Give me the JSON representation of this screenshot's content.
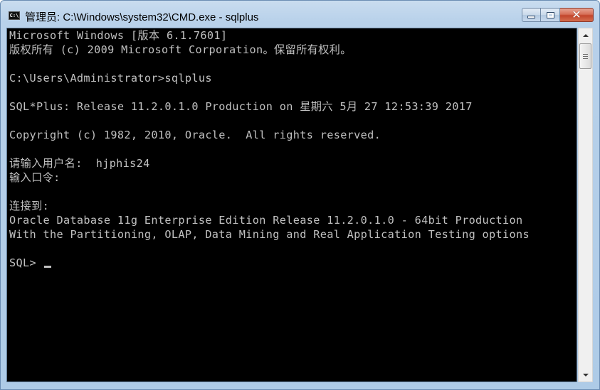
{
  "window": {
    "title": "管理员: C:\\Windows\\system32\\CMD.exe - sqlplus",
    "icon_label": "C:\\",
    "icon": "cmd-console-icon",
    "buttons": {
      "minimize": "minimize-icon",
      "maximize": "maximize-icon",
      "close": "close-icon",
      "close_glyph": "✕"
    }
  },
  "console": {
    "lines": [
      "Microsoft Windows [版本 6.1.7601]",
      "版权所有 (c) 2009 Microsoft Corporation。保留所有权利。",
      "",
      "C:\\Users\\Administrator>sqlplus",
      "",
      "SQL*Plus: Release 11.2.0.1.0 Production on 星期六 5月 27 12:53:39 2017",
      "",
      "Copyright (c) 1982, 2010, Oracle.  All rights reserved.",
      "",
      "请输入用户名:  hjphis24",
      "输入口令:",
      "",
      "连接到:",
      "Oracle Database 11g Enterprise Edition Release 11.2.0.1.0 - 64bit Production",
      "With the Partitioning, OLAP, Data Mining and Real Application Testing options",
      ""
    ],
    "prompt": "SQL> "
  },
  "colors": {
    "console_background": "#000000",
    "console_text": "#c0c0c0",
    "close_button": "#c3452b"
  }
}
